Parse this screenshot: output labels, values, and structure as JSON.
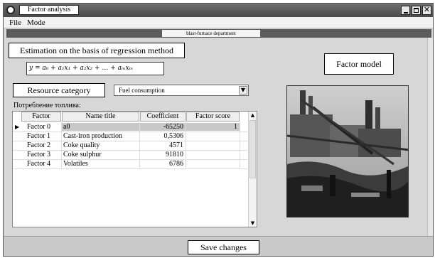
{
  "window": {
    "title": "Factor analysis"
  },
  "menu": {
    "items": [
      "File",
      "Mode"
    ]
  },
  "department": {
    "label": "blast-furnace department"
  },
  "estimation": {
    "label": "Estimation on the basis of regression method"
  },
  "formula": {
    "text": "y = a₀ + a₁x₁ + a₂x₂ + … + aₘxₘ"
  },
  "factor_model": {
    "label": "Factor model"
  },
  "resource": {
    "label": "Resource category",
    "selected": "Fuel consumption"
  },
  "grid": {
    "caption": "Потребление топлива:",
    "columns": [
      "Factor",
      "Name title",
      "Coefficient",
      "Factor score"
    ],
    "rows": [
      {
        "factor": "Factor 0",
        "name": "a0",
        "coefficient": "-65250",
        "score": "1",
        "selected": true
      },
      {
        "factor": "Factor 1",
        "name": "Cast-iron production",
        "coefficient": "0,5306",
        "score": ""
      },
      {
        "factor": "Factor 2",
        "name": "Coke quality",
        "coefficient": "4571",
        "score": ""
      },
      {
        "factor": "Factor 3",
        "name": "Coke sulphur",
        "coefficient": "91810",
        "score": ""
      },
      {
        "factor": "Factor 4",
        "name": "Volatiles",
        "coefficient": "6786",
        "score": ""
      }
    ]
  },
  "save": {
    "label": "Save changes"
  },
  "icons": {
    "app": "app-icon",
    "minimize": "minimize-icon",
    "maximize": "maximize-icon",
    "close": "close-icon",
    "dropdown": "chevron-down-icon",
    "row_pointer": "row-pointer-icon"
  }
}
